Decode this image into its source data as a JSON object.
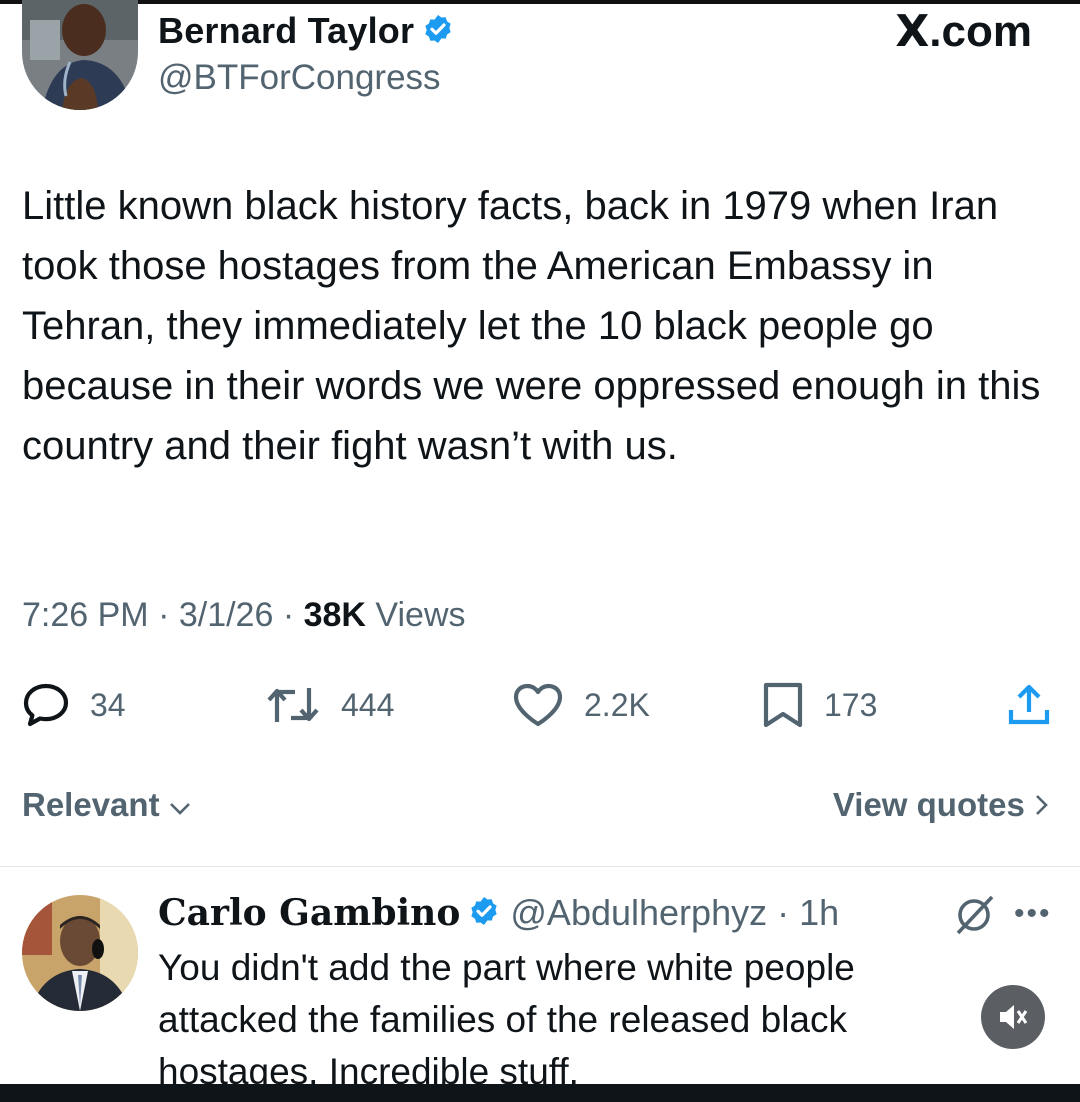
{
  "brand": {
    "logo_text": "X",
    "suffix": ".com"
  },
  "tweet": {
    "author_name": "Bernard Taylor",
    "handle": "@BTForCongress",
    "text": "Little known black history facts, back in 1979 when Iran took those hostages from the American Embassy in Tehran, they immediately let the 10 black people go because in their words we were oppressed enough in this country and their fight wasn’t with us.",
    "time": "7:26 PM",
    "date": "3/1/26",
    "views_count": "38K",
    "views_label": "Views",
    "separator": " · "
  },
  "actions": {
    "replies": "34",
    "reposts": "444",
    "likes": "2.2K",
    "bookmarks": "173"
  },
  "filters": {
    "sort_label": "Relevant",
    "quotes_label": "View quotes"
  },
  "reply": {
    "author_name": "Carlo Gambino",
    "handle": "@Abdulherphyz",
    "age": "1h",
    "text": "You didn't add the part where white people attacked the families of the released black hostages. Incredible stuff."
  },
  "icons": {
    "verified": "verified-badge-icon",
    "reply": "reply-bubble-icon",
    "repost": "repost-icon",
    "like": "heart-icon",
    "bookmark": "bookmark-icon",
    "share": "share-upload-icon",
    "grok": "grok-icon",
    "more": "more-dots-icon",
    "mute": "speaker-muted-icon"
  },
  "colors": {
    "verified": "#1d9bf0",
    "secondary_text": "#536471",
    "primary_text": "#0f1419"
  }
}
